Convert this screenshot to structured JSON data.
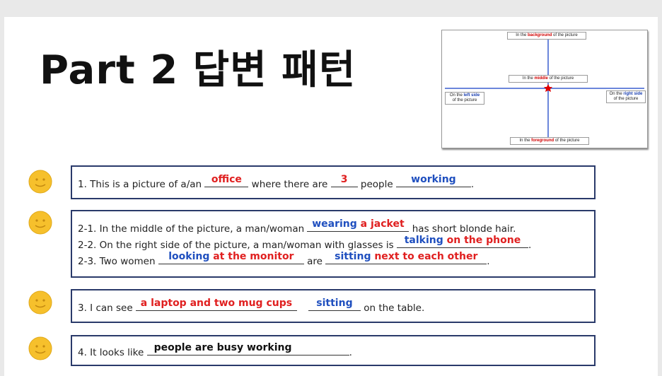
{
  "title": "Part 2 답변 패턴",
  "diagram": {
    "top": {
      "pre": "In the ",
      "key": "background",
      "post": " of the picture"
    },
    "middle": {
      "pre": "In the ",
      "key": "middle",
      "post": " of the picture"
    },
    "left": {
      "pre": "On the ",
      "key": "left side",
      "post": "of the picture"
    },
    "right": {
      "pre": "On the ",
      "key": "right side",
      "post": "of the picture"
    },
    "bottom": {
      "pre": "In the ",
      "key": "foreground",
      "post": " of the picture"
    }
  },
  "q1": {
    "t1": "1. This is a picture of a/an ",
    "a1": "office",
    "t2": " where there are ",
    "a2": "3",
    "t3": " people ",
    "a3": "working",
    "t4": "."
  },
  "q2": {
    "l1": {
      "t1": "2-1. In the middle of the picture, a man/woman ",
      "a_blue": "wearing",
      "a_red": " a jacket",
      "t2": " has short blonde hair."
    },
    "l2": {
      "t1": "2-2. On the right side of the picture, a man/woman with glasses is ",
      "a_blue": "talking",
      "a_red": " on the phone",
      "t2": "."
    },
    "l3": {
      "t1": "2-3. Two women ",
      "a1_blue": "looking",
      "a1_red": " at the monitor",
      "t2": " are ",
      "a2_blue": "sitting",
      "a2_red": " next to each other",
      "t3": "."
    }
  },
  "q3": {
    "t1": "3. I can see ",
    "a1": "a laptop and two mug cups",
    "a2": "sitting",
    "t2": " on the table."
  },
  "q4": {
    "t1": "4. It looks like ",
    "a1": "people are busy working",
    "t2": "."
  }
}
